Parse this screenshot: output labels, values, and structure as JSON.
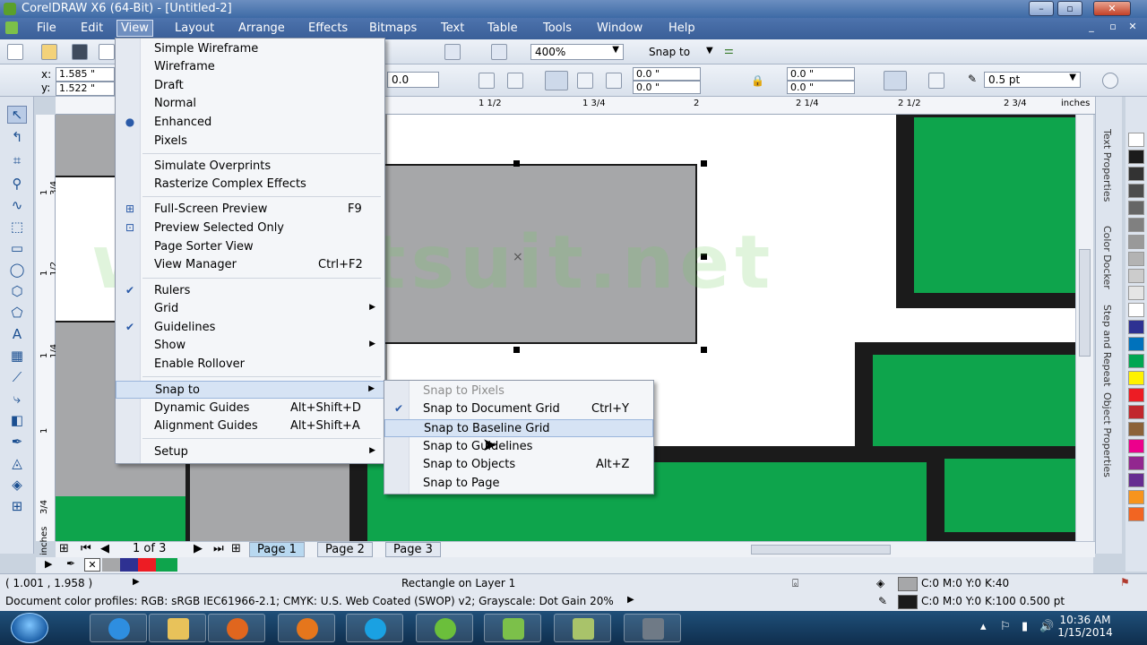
{
  "window": {
    "title": "CorelDRAW X6 (64-Bit) - [Untitled-2]",
    "buttons": [
      "–",
      "▫",
      "✕"
    ]
  },
  "menubar": {
    "items": [
      "File",
      "Edit",
      "View",
      "Layout",
      "Arrange",
      "Effects",
      "Bitmaps",
      "Text",
      "Table",
      "Tools",
      "Window",
      "Help"
    ],
    "active": "View"
  },
  "toolbar": {
    "zoom": "400%",
    "snap": "Snap to"
  },
  "property_bar": {
    "x_label": "x:",
    "x": "1.585 \"",
    "y_label": "y:",
    "y": "1.522 \"",
    "angle": "0.0",
    "corner_tl": "0.0 \"",
    "corner_bl": "0.0 \"",
    "corner_tr": "0.0 \"",
    "corner_br": "0.0 \"",
    "outline": "0.5 pt"
  },
  "ruler": {
    "h_ticks": [
      "1 1/2",
      "1 3/4",
      "2",
      "2 1/4",
      "2 1/2",
      "2 3/4",
      "inches"
    ],
    "v_ticks": [
      "1 3/4",
      "1 1/2",
      "1 1/4",
      "1",
      "3/4",
      "inches"
    ]
  },
  "watermark": "www.itsuit.net",
  "view_menu": {
    "items": [
      {
        "label": "Simple Wireframe"
      },
      {
        "label": "Wireframe"
      },
      {
        "label": "Draft"
      },
      {
        "label": "Normal"
      },
      {
        "label": "Enhanced",
        "mark": "●"
      },
      {
        "label": "Pixels"
      },
      {
        "label": "Simulate Overprints"
      },
      {
        "label": "Rasterize Complex Effects"
      },
      {
        "label": "Full-Screen Preview",
        "shortcut": "F9"
      },
      {
        "label": "Preview Selected Only"
      },
      {
        "label": "Page Sorter View"
      },
      {
        "label": "View Manager",
        "shortcut": "Ctrl+F2"
      },
      {
        "label": "Rulers",
        "mark": "✔"
      },
      {
        "label": "Grid",
        "sub": "▶"
      },
      {
        "label": "Guidelines",
        "mark": "✔"
      },
      {
        "label": "Show",
        "sub": "▶"
      },
      {
        "label": "Enable Rollover"
      },
      {
        "label": "Snap to",
        "sub": "▶"
      },
      {
        "label": "Dynamic Guides",
        "shortcut": "Alt+Shift+D"
      },
      {
        "label": "Alignment Guides",
        "shortcut": "Alt+Shift+A"
      },
      {
        "label": "Setup",
        "sub": "▶"
      }
    ]
  },
  "snap_menu": {
    "items": [
      {
        "label": "Snap to Pixels"
      },
      {
        "label": "Snap to Document Grid",
        "shortcut": "Ctrl+Y",
        "mark": "✔"
      },
      {
        "label": "Snap to Baseline Grid"
      },
      {
        "label": "Snap to Guidelines"
      },
      {
        "label": "Snap to Objects",
        "shortcut": "Alt+Z"
      },
      {
        "label": "Snap to Page"
      }
    ]
  },
  "pages": {
    "counter": "1 of 3",
    "tabs": [
      "Page 1",
      "Page 2",
      "Page 3"
    ]
  },
  "dockers": [
    "Text Properties",
    "Color Docker",
    "Step and Repeat",
    "Object Properties"
  ],
  "status": {
    "coords": "( 1.001 , 1.958 )",
    "object": "Rectangle on Layer 1",
    "fill": "C:0 M:0 Y:0 K:40",
    "outline": "C:0 M:0 Y:0 K:100  0.500 pt",
    "profiles": "Document color profiles: RGB: sRGB IEC61966-2.1; CMYK: U.S. Web Coated (SWOP) v2; Grayscale: Dot Gain 20%"
  },
  "taskbar": {
    "time": "10:36 AM",
    "date": "1/15/2014"
  },
  "colors": {
    "green": "#0ea44c",
    "gray": "#a6a7a9",
    "dark": "#1b1b1b",
    "palette": [
      "#ffffff",
      "#1b1b1b",
      "#333333",
      "#4d4d4d",
      "#666666",
      "#808080",
      "#999999",
      "#b3b3b3",
      "#cccccc",
      "#e5e5e5",
      "#ffffff",
      "#2e3192",
      "#0072bc",
      "#00a651",
      "#fff200",
      "#ed1c24",
      "#c1272d",
      "#8c6239",
      "#ec008c",
      "#92278f",
      "#662d91",
      "#f7941d",
      "#f26522"
    ]
  }
}
